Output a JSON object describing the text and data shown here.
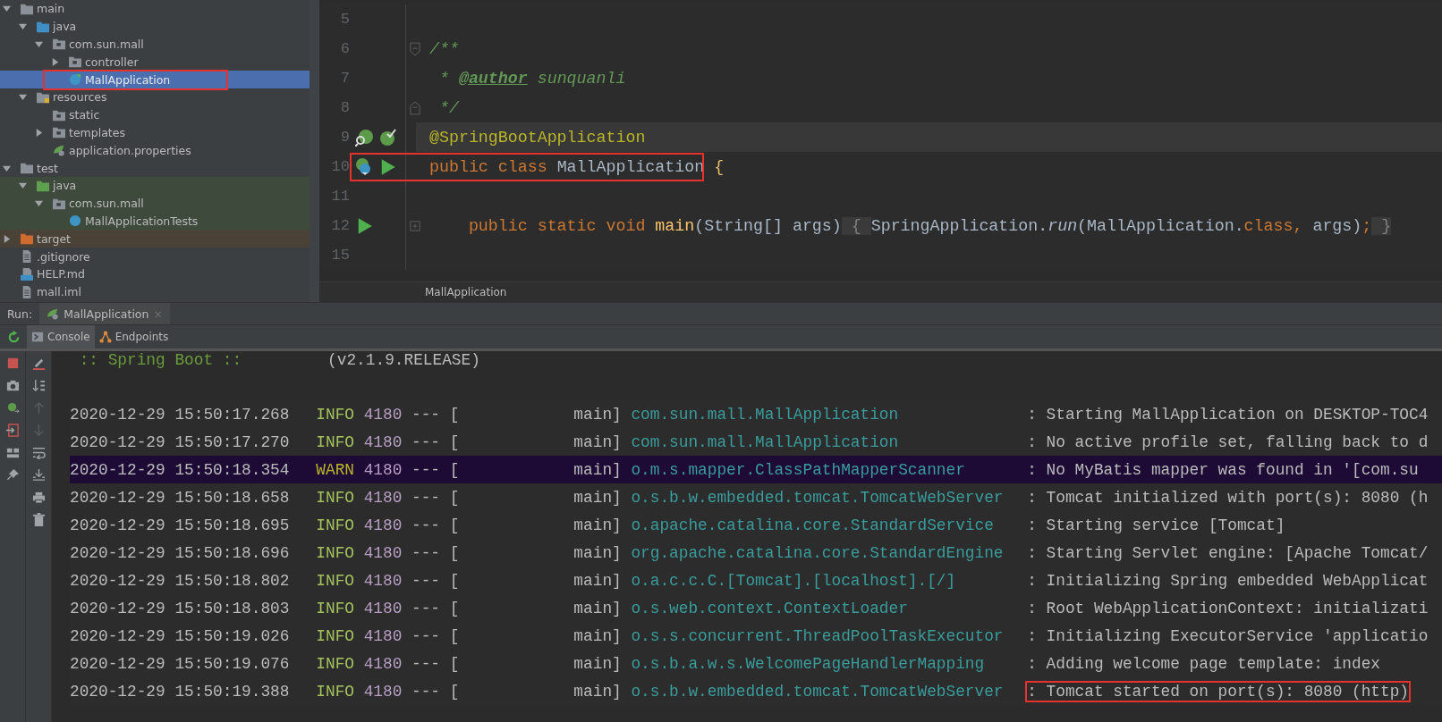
{
  "project_tree": [
    {
      "label": "main",
      "kind": "folder",
      "expanded": true,
      "boxed": false,
      "selected": false,
      "children": [
        {
          "label": "java",
          "kind": "source-folder",
          "expanded": true,
          "boxed": false,
          "selected": false,
          "children": [
            {
              "label": "com.sun.mall",
              "kind": "package",
              "expanded": true,
              "boxed": false,
              "selected": false,
              "children": [
                {
                  "label": "controller",
                  "kind": "package",
                  "expanded": false,
                  "boxed": false,
                  "selected": false
                },
                {
                  "label": "MallApplication",
                  "kind": "spring-class",
                  "boxed": true,
                  "selected": true
                }
              ]
            }
          ]
        },
        {
          "label": "resources",
          "kind": "resources-folder",
          "expanded": true,
          "boxed": false,
          "selected": false,
          "children": [
            {
              "label": "static",
              "kind": "package",
              "boxed": false,
              "selected": false
            },
            {
              "label": "templates",
              "kind": "package",
              "expanded": false,
              "boxed": false,
              "selected": false
            },
            {
              "label": "application.properties",
              "kind": "properties",
              "boxed": false,
              "selected": false
            }
          ]
        }
      ]
    },
    {
      "label": "test",
      "kind": "folder",
      "expanded": true,
      "boxed": false,
      "selected": false,
      "children": [
        {
          "label": "java",
          "kind": "test-folder",
          "expanded": true,
          "boxed": false,
          "selected": false,
          "children": [
            {
              "label": "com.sun.mall",
              "kind": "package",
              "expanded": true,
              "boxed": false,
              "selected": false,
              "children": [
                {
                  "label": "MallApplicationTests",
                  "kind": "class",
                  "boxed": false,
                  "selected": false
                }
              ]
            }
          ]
        }
      ]
    },
    {
      "label": "target",
      "kind": "excluded-folder",
      "expanded": false,
      "boxed": false,
      "selected": false
    },
    {
      "label": ".gitignore",
      "kind": "file",
      "boxed": false,
      "selected": false
    },
    {
      "label": "HELP.md",
      "kind": "markdown",
      "boxed": false,
      "selected": false
    },
    {
      "label": "mall.iml",
      "kind": "file",
      "boxed": false,
      "selected": false
    }
  ],
  "editor": {
    "lines": [
      {
        "number": "5",
        "current": false,
        "boxed": false
      },
      {
        "number": "6",
        "current": false,
        "boxed": false,
        "fold_marker": {
          "kind": "open"
        },
        "tokens": [
          {
            "kind": "comment",
            "text": "/**"
          }
        ]
      },
      {
        "number": "7",
        "current": false,
        "boxed": false,
        "tokens": [
          {
            "kind": "comment",
            "text": " * "
          },
          {
            "kind": "doctag",
            "text": "@author"
          },
          {
            "kind": "comment",
            "text": " sunquanli"
          }
        ]
      },
      {
        "number": "8",
        "current": false,
        "boxed": false,
        "fold_marker": {
          "kind": "close"
        },
        "tokens": [
          {
            "kind": "comment",
            "text": " */"
          }
        ]
      },
      {
        "number": "9",
        "current": true,
        "boxed": false,
        "gutter": [
          {
            "kind": "spring-search"
          },
          {
            "kind": "spring-check"
          }
        ],
        "tokens": [
          {
            "kind": "annotation",
            "text": "@SpringBootApplication"
          }
        ]
      },
      {
        "number": "10",
        "current": false,
        "boxed": true,
        "gutter": [
          {
            "kind": "spring-bean"
          },
          {
            "kind": "run"
          }
        ],
        "tokens": [
          {
            "kind": "keyword",
            "text": "public class "
          },
          {
            "kind": "plain",
            "text": "MallApplication"
          },
          {
            "kind": "brace",
            "text": " {"
          }
        ]
      },
      {
        "number": "11",
        "current": false,
        "boxed": false
      },
      {
        "number": "12",
        "current": false,
        "boxed": false,
        "gutter": [
          {
            "kind": "run"
          }
        ],
        "fold_marker": {
          "kind": "collapsed"
        },
        "tokens": [
          {
            "kind": "keyword",
            "text": "    public static void "
          },
          {
            "kind": "method",
            "text": "main"
          },
          {
            "kind": "plain",
            "text": "(String[] args)"
          },
          {
            "kind": "folded",
            "text": " { "
          },
          {
            "kind": "plain",
            "text": "SpringApplication."
          },
          {
            "kind": "italic",
            "text": "run"
          },
          {
            "kind": "plain",
            "text": "(MallApplication."
          },
          {
            "kind": "keyword",
            "text": "class, "
          },
          {
            "kind": "plain",
            "text": "args)"
          },
          {
            "kind": "keyword",
            "text": ";"
          },
          {
            "kind": "folded",
            "text": " }"
          }
        ]
      },
      {
        "number": "15",
        "current": false,
        "boxed": false
      }
    ],
    "breadcrumb": "MallApplication"
  },
  "run_bar": {
    "label": "Run:",
    "tab": {
      "title": "MallApplication",
      "close": "×"
    }
  },
  "console_tabs": [
    {
      "label": "Console",
      "selected": true
    },
    {
      "label": "Endpoints",
      "selected": false
    }
  ],
  "console": {
    "banner": {
      "title": " :: Spring Boot :: ",
      "version": "(v2.1.9.RELEASE)"
    },
    "rows": [
      {
        "time": "2020-12-29 15:50:17.268",
        "level": "INFO",
        "pid": "4180",
        "dashes": "---",
        "thread": "[            main]",
        "logger": "com.sun.mall.MallApplication",
        "message": ": Starting MallApplication on DESKTOP-TOC4",
        "selected": false,
        "boxed": false
      },
      {
        "time": "2020-12-29 15:50:17.270",
        "level": "INFO",
        "pid": "4180",
        "dashes": "---",
        "thread": "[            main]",
        "logger": "com.sun.mall.MallApplication",
        "message": ": No active profile set, falling back to d",
        "selected": false,
        "boxed": false
      },
      {
        "time": "2020-12-29 15:50:18.354",
        "level": "WARN",
        "pid": "4180",
        "dashes": "---",
        "thread": "[            main]",
        "logger": "o.m.s.mapper.ClassPathMapperScanner",
        "message": ": No MyBatis mapper was found in '[com.su",
        "selected": true,
        "boxed": false
      },
      {
        "time": "2020-12-29 15:50:18.658",
        "level": "INFO",
        "pid": "4180",
        "dashes": "---",
        "thread": "[            main]",
        "logger": "o.s.b.w.embedded.tomcat.TomcatWebServer",
        "message": ": Tomcat initialized with port(s): 8080 (h",
        "selected": false,
        "boxed": false
      },
      {
        "time": "2020-12-29 15:50:18.695",
        "level": "INFO",
        "pid": "4180",
        "dashes": "---",
        "thread": "[            main]",
        "logger": "o.apache.catalina.core.StandardService",
        "message": ": Starting service [Tomcat]",
        "selected": false,
        "boxed": false
      },
      {
        "time": "2020-12-29 15:50:18.696",
        "level": "INFO",
        "pid": "4180",
        "dashes": "---",
        "thread": "[            main]",
        "logger": "org.apache.catalina.core.StandardEngine",
        "message": ": Starting Servlet engine: [Apache Tomcat/",
        "selected": false,
        "boxed": false
      },
      {
        "time": "2020-12-29 15:50:18.802",
        "level": "INFO",
        "pid": "4180",
        "dashes": "---",
        "thread": "[            main]",
        "logger": "o.a.c.c.C.[Tomcat].[localhost].[/]",
        "message": ": Initializing Spring embedded WebApplicat",
        "selected": false,
        "boxed": false
      },
      {
        "time": "2020-12-29 15:50:18.803",
        "level": "INFO",
        "pid": "4180",
        "dashes": "---",
        "thread": "[            main]",
        "logger": "o.s.web.context.ContextLoader",
        "message": ": Root WebApplicationContext: initializati",
        "selected": false,
        "boxed": false
      },
      {
        "time": "2020-12-29 15:50:19.026",
        "level": "INFO",
        "pid": "4180",
        "dashes": "---",
        "thread": "[            main]",
        "logger": "o.s.s.concurrent.ThreadPoolTaskExecutor",
        "message": ": Initializing ExecutorService 'applicatio",
        "selected": false,
        "boxed": false
      },
      {
        "time": "2020-12-29 15:50:19.076",
        "level": "INFO",
        "pid": "4180",
        "dashes": "---",
        "thread": "[            main]",
        "logger": "o.s.b.a.w.s.WelcomePageHandlerMapping",
        "message": ": Adding welcome page template: index",
        "selected": false,
        "boxed": false
      },
      {
        "time": "2020-12-29 15:50:19.388",
        "level": "INFO",
        "pid": "4180",
        "dashes": "---",
        "thread": "[            main]",
        "logger": "o.s.b.w.embedded.tomcat.TomcatWebServer",
        "message": ": Tomcat started on port(s): 8080 (http)",
        "selected": false,
        "boxed": true
      }
    ]
  }
}
